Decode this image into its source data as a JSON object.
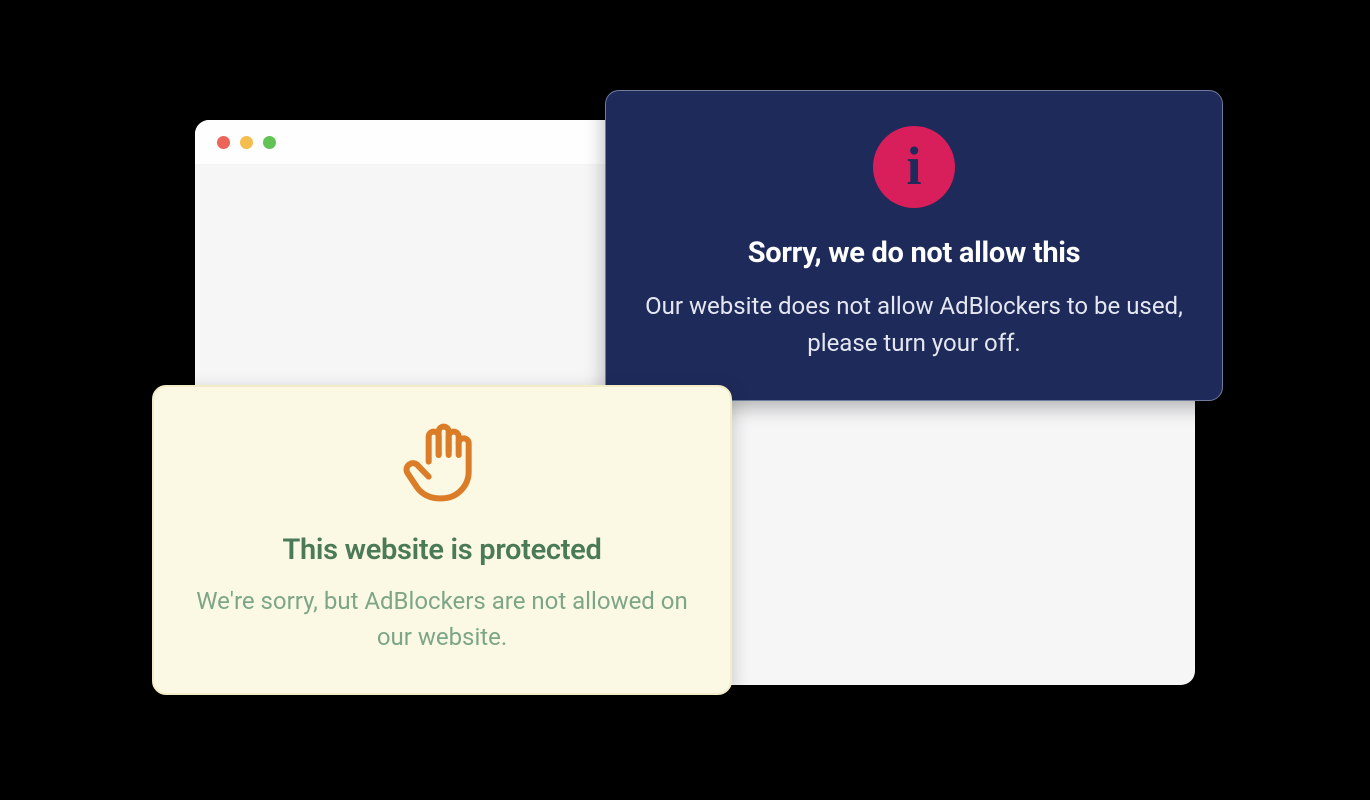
{
  "colors": {
    "trafficRed": "#eb6559",
    "trafficYellow": "#f4be4f",
    "trafficGreen": "#61c354",
    "darkCardBg": "#1e2a5a",
    "infoBadge": "#d81e5b",
    "lightCardBg": "#fbf9e3",
    "handIcon": "#db7d28"
  },
  "darkCard": {
    "title": "Sorry, we do not allow this",
    "body": "Our website does not allow AdBlockers to be used, please turn your off."
  },
  "lightCard": {
    "title": "This website is protected",
    "body": "We're sorry, but AdBlockers are not allowed on our website."
  }
}
